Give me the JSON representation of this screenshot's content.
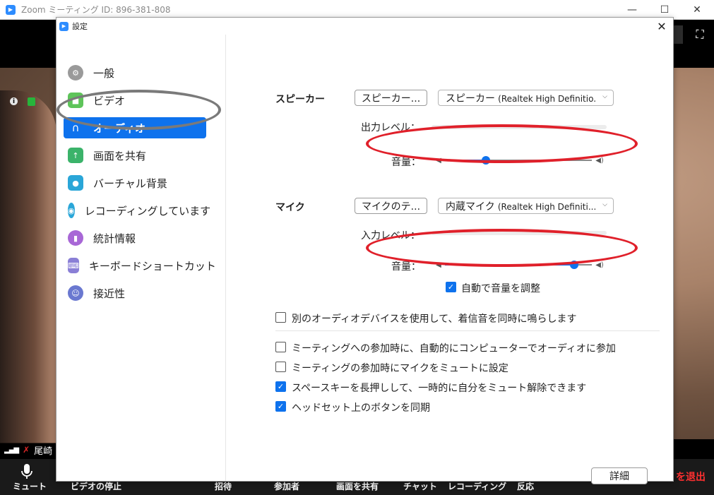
{
  "meeting": {
    "window_title": "Zoom ミーティング ID: 896-381-808",
    "minimize": "—",
    "maximize": "☐",
    "close": "✕",
    "participant_name": "尾崎",
    "toolbar": {
      "mute": "ミュート",
      "stop_video": "ビデオの停止",
      "invite": "招待",
      "participants": "参加者",
      "share": "画面を共有",
      "chat": "チャット",
      "record": "レコーディング",
      "reactions": "反応",
      "leave": "を退出"
    }
  },
  "dialog": {
    "title": "設定",
    "close": "✕"
  },
  "sidebar": {
    "items": [
      {
        "label": "一般"
      },
      {
        "label": "ビデオ"
      },
      {
        "label": "オーディオ"
      },
      {
        "label": "画面を共有"
      },
      {
        "label": "バーチャル背景"
      },
      {
        "label": "レコーディングしています"
      },
      {
        "label": "統計情報"
      },
      {
        "label": "キーボードショートカット"
      },
      {
        "label": "接近性"
      }
    ]
  },
  "audio": {
    "speaker": {
      "label": "スピーカー",
      "test_button": "スピーカー...",
      "device_name": "スピーカー",
      "device_detail": "(Realtek High Definitio...",
      "output_level_label": "出力レベル：",
      "volume_label": "音量：",
      "volume_percent": 28
    },
    "mic": {
      "label": "マイク",
      "test_button": "マイクのテ...",
      "device_name": "内蔵マイク",
      "device_detail": "(Realtek High Definiti...",
      "input_level_label": "入力レベル：",
      "volume_label": "音量：",
      "volume_percent": 88,
      "auto_adjust_label": "自動で音量を調整"
    },
    "options": {
      "separate_device": "別のオーディオデバイスを使用して、着信音を同時に鳴らします",
      "auto_join": "ミーティングへの参加時に、自動的にコンピューターでオーディオに参加",
      "mute_on_join": "ミーティングの参加時にマイクをミュートに設定",
      "space_unmute": "スペースキーを長押しして、一時的に自分をミュート解除できます",
      "headset_sync": "ヘッドセット上のボタンを同期"
    },
    "advanced_button": "詳細"
  },
  "colors": {
    "accent": "#0e72ed",
    "annotation_red": "#e0202a",
    "annotation_gray": "#7a7a7a"
  }
}
